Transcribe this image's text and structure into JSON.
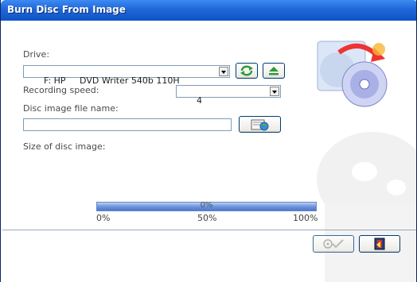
{
  "window": {
    "title": "Burn Disc From Image"
  },
  "drive": {
    "label": "Drive:",
    "selected": "F: HP     DVD Writer 540b 110H"
  },
  "speed": {
    "label": "Recording speed:",
    "selected": "4"
  },
  "image_file": {
    "label": "Disc image file name:",
    "value": ""
  },
  "size": {
    "label": "Size of disc image:"
  },
  "progress": {
    "value": "0%",
    "scale": [
      "0%",
      "50%",
      "100%"
    ]
  },
  "icons": {
    "refresh": "refresh-icon",
    "eject": "eject-icon",
    "browse": "browse-folder-icon",
    "burn": "burn-check-icon",
    "exit": "exit-icon",
    "logo": "disc-logo-icon"
  },
  "colors": {
    "titlebar": "#1f67d9",
    "accent_green": "#2e9a35",
    "progress": "#6f95dd"
  }
}
